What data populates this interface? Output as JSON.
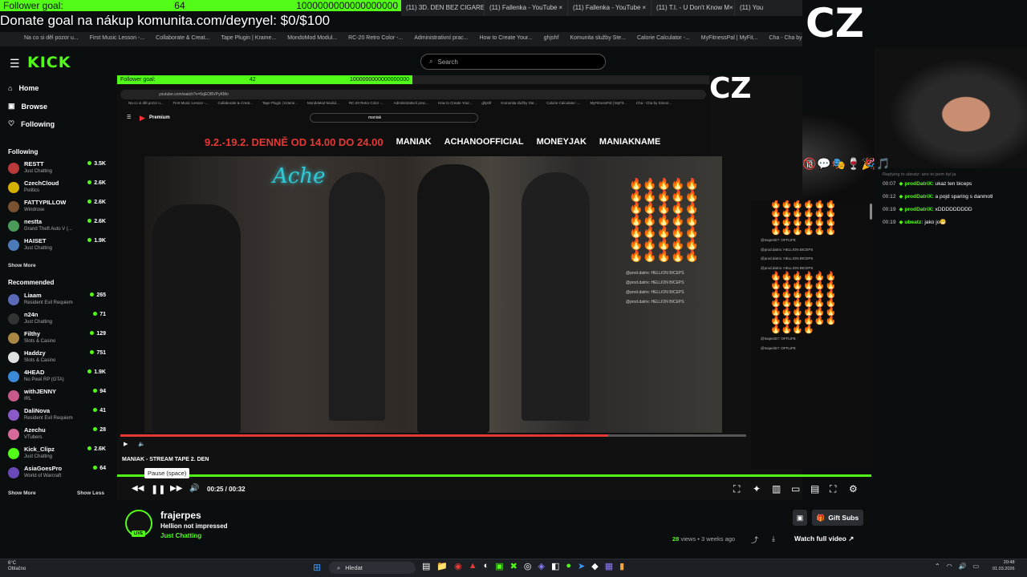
{
  "overlay": {
    "follower_goal_label": "Follower goal:",
    "follower_goal_value": "64",
    "follower_goal_target": "1000000000000000000",
    "donate_text": "Donate goal na nákup komunita.com/deynyel: $0/$100",
    "cz_label": "CZ"
  },
  "browser_tabs": [
    "(11) 3D. DEN BEZ CIGARE",
    "(11) Fallenka - YouTube",
    "(11) Fallenka - YouTube",
    "(11) T.I. - U Don't Know M",
    "(11) You"
  ],
  "bookmarks": [
    "Na co si děl pozor u...",
    "First Music Lesson -...",
    "Collaborate & Creat...",
    "Tape Plugin | Krame...",
    "MondoMod Modul...",
    "RC-20 Retro Color -...",
    "Administrativní prac...",
    "How to Create Your...",
    "ghjshf",
    "Komunita služby Ste...",
    "Calorie Calculator -...",
    "MyFitnessPal | MyFit...",
    "Cha - Cha by Simon..."
  ],
  "kick": {
    "logo": "KICK",
    "search_placeholder": "Search",
    "nav": {
      "home": "Home",
      "browse": "Browse",
      "following": "Following"
    },
    "following_header": "Following",
    "following": [
      {
        "name": "RESTT",
        "category": "Just Chatting",
        "viewers": "3.5K",
        "color": "#b83a3a"
      },
      {
        "name": "CzechCloud",
        "category": "Politics",
        "viewers": "2.6K",
        "color": "#d4b000"
      },
      {
        "name": "FATTYPILLOW",
        "category": "Windrose",
        "viewers": "2.6K",
        "color": "#7a5230"
      },
      {
        "name": "nestta",
        "category": "Grand Theft Auto V (...",
        "viewers": "2.6K",
        "color": "#4a9a5a"
      },
      {
        "name": "HAISET",
        "category": "Just Chatting",
        "viewers": "1.9K",
        "color": "#4a7ab8"
      }
    ],
    "show_more": "Show More",
    "recommended_header": "Recommended",
    "recommended": [
      {
        "name": "Liaam",
        "category": "Resident Evil Requiem",
        "viewers": "265",
        "color": "#5a6ab8"
      },
      {
        "name": "n24n",
        "category": "Just Chatting",
        "viewers": "71",
        "color": "#333333"
      },
      {
        "name": "Filthy",
        "category": "Slots & Casino",
        "viewers": "129",
        "color": "#aa8844"
      },
      {
        "name": "Haddzy",
        "category": "Slots & Casino",
        "viewers": "751",
        "color": "#e0e0e0"
      },
      {
        "name": "4HEAD",
        "category": "No Pixel RP (GTA)",
        "viewers": "1.9K",
        "color": "#3a8ad8"
      },
      {
        "name": "withJENNY",
        "category": "IRL",
        "viewers": "94",
        "color": "#c85a8a"
      },
      {
        "name": "DaliNova",
        "category": "Resident Evil Requiem",
        "viewers": "41",
        "color": "#8a5ac8"
      },
      {
        "name": "Azechu",
        "category": "VTubers",
        "viewers": "28",
        "color": "#d86a9a"
      },
      {
        "name": "Kick_Clipz",
        "category": "Just Chatting",
        "viewers": "2.6K",
        "color": "#53fc18"
      },
      {
        "name": "AsiaGoesPro",
        "category": "World of Warcraft",
        "viewers": "64",
        "color": "#6a4ab8"
      }
    ],
    "show_more_2": "Show More",
    "show_less": "Show Less"
  },
  "video": {
    "inner_goal_label": "Follower goal:",
    "inner_goal_value": "42",
    "inner_goal_target": "1000000000000000000",
    "url": "youtube.com/watch?v=5qEOBVPyKMo",
    "yt_premium": "Premium",
    "yt_search": "maniak",
    "banner_dates": "9.2.-19.2. DENNĚ OD 14.00 DO 24.00",
    "banner_social": [
      "MANIAK",
      "ACHANOOFFICIAL",
      "MONEYJAK",
      "MANIAKNAME"
    ],
    "neon_text": "Ache",
    "yt_title": "MANIAK - STREAM TAPE 2. DEN",
    "tooltip": "Pause (space)",
    "time": "00:25 / 00:32",
    "progress": 0.78
  },
  "inner_chat_lines": [
    "@tvapeit27: OFFLIFE",
    "@prod.datrix: HELLION BICEPS",
    "@prod.datrix: HELLION BICEPS",
    "@prod.datrix: HELLION BICEPS",
    "@prod.datrix: HELLION BICEPS"
  ],
  "side_chat": {
    "reply_note": "Replying to ubeatz: ano to jsem byl ja",
    "messages": [
      {
        "time": "00:07",
        "user": "prodDatriX:",
        "text": "ukaz ten biceps"
      },
      {
        "time": "00:12",
        "user": "prodDatriX:",
        "text": "a pojd sparing s danmotl"
      },
      {
        "time": "00:19",
        "user": "prodDatriX:",
        "text": "xDDDDDDDDD"
      },
      {
        "time": "00:19",
        "user": "ubeatz:",
        "text": "jako jo😁"
      }
    ]
  },
  "channel": {
    "name": "frajerpes",
    "title": "Hellion not impressed",
    "category": "Just Chatting",
    "live_badge": "LIVE",
    "gift_subs": "Gift Subs",
    "views_count": "28",
    "views_rest": "views • 3 weeks ago",
    "watch_full": "Watch full video"
  },
  "taskbar": {
    "weather_temp": "6°C",
    "weather_desc": "Oblačno",
    "search": "Hledat",
    "time": "20:48",
    "date": "01.03.2026"
  }
}
